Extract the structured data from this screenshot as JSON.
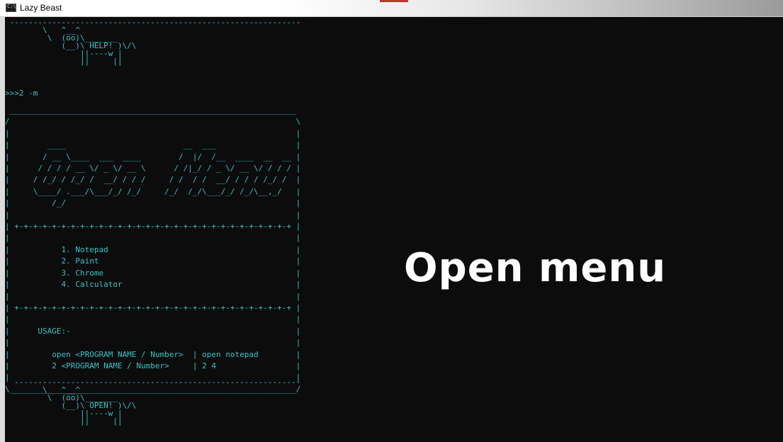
{
  "window": {
    "title": "Lazy Beast",
    "icon": "console-icon"
  },
  "terminal": {
    "cow_help": " --------------------------------------------------------------\n        \\   ^__^\n         \\  (oo)\\_______\n            (__)\\ HELP! )\\/\\\n                ||----w |\n                ||     ||",
    "prompt": ">>>2 -m",
    "menu": " _____________________________________________________________\n/                                                             \\\n|                                                             |\n|        ____                         __  ___                 |\n|       / __ \\____  ___  ____        /  |/  /__  ____  __  __ |\n|      / / / / __ \\/ _ \\/ __ \\      / /|_/ / _ \\/ __ \\/ / / / |\n|     / /_/ / /_/ /  __/ / / /     / /  / /  __/ / / / /_/ /  |\n|     \\____/ .___/\\___/_/ /_/     /_/  /_/\\___/_/ /_/\\__,_/   |\n|         /_/                                                 |\n|                                                             |\n| +-+-+-+-+-+-+-+-+-+-+-+-+-+-+-+-+-+-+-+-+-+-+-+-+-+-+-+-+-+ |\n|                                                             |\n|           1. Notepad                                        |\n|           2. Paint                                          |\n|           3. Chrome                                         |\n|           4. Calculator                                     |\n|                                                             |\n| +-+-+-+-+-+-+-+-+-+-+-+-+-+-+-+-+-+-+-+-+-+-+-+-+-+-+-+-+-+ |\n|                                                             |\n|      USAGE:-                                                |\n|                                                             |\n|         open <PROGRAM NAME / Number>  | open notepad        |\n|         2 <PROGRAM NAME / Number>     | 2 4                 |\n|                                                             |\n\\_____________________________________________________________/",
    "cow_open": "  -------------------------------------------------------------\n        \\   ^__^\n         \\  (oo)\\_______\n            (__)\\ OPEN! )\\/\\\n                ||----w |\n                ||     ||"
  },
  "overlay": {
    "caption": "Open menu"
  },
  "colors": {
    "terminal_bg": "#0c0c0c",
    "terminal_text": "#39c2c7",
    "caption": "#ffffff"
  }
}
